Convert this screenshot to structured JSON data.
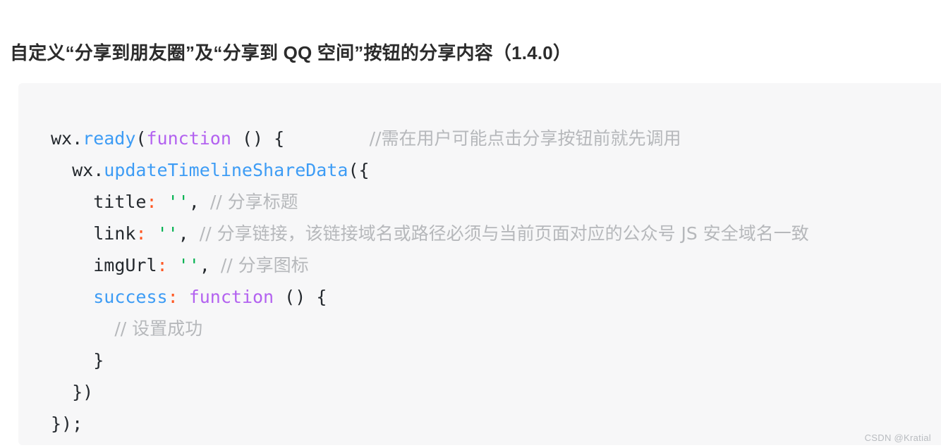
{
  "page": {
    "title": "自定义“分享到朋友圈”及“分享到 QQ 空间”按钮的分享内容（1.4.0）",
    "watermark": "CSDN @Kratial",
    "background_color": "#ffffff"
  },
  "code_block": {
    "background_color": "#f7f7f8",
    "language": "javascript",
    "syntax_colors": {
      "plain": "#24292e",
      "property": "#3d9cf5",
      "keyword": "#b362f0",
      "string": "#00b14f",
      "punctuation": "#ff5722",
      "comment": "#b6b8bb"
    },
    "lines": [
      {
        "indent": "",
        "tokens": [
          {
            "type": "plain",
            "text": "wx."
          },
          {
            "type": "property",
            "text": "ready"
          },
          {
            "type": "plain",
            "text": "("
          },
          {
            "type": "keyword",
            "text": "function"
          },
          {
            "type": "plain",
            "text": " () {"
          },
          {
            "type": "plain",
            "text": "        "
          },
          {
            "type": "comment",
            "text": "//需在用户可能点击分享按钮前就先调用"
          }
        ]
      },
      {
        "indent": "  ",
        "tokens": [
          {
            "type": "plain",
            "text": "wx."
          },
          {
            "type": "property",
            "text": "updateTimelineShareData"
          },
          {
            "type": "plain",
            "text": "({"
          }
        ]
      },
      {
        "indent": "    ",
        "tokens": [
          {
            "type": "plain",
            "text": "title"
          },
          {
            "type": "punctuation",
            "text": ":"
          },
          {
            "type": "plain",
            "text": " "
          },
          {
            "type": "string",
            "text": "''"
          },
          {
            "type": "plain",
            "text": ", "
          },
          {
            "type": "comment",
            "text": "// 分享标题"
          }
        ]
      },
      {
        "indent": "    ",
        "tokens": [
          {
            "type": "plain",
            "text": "link"
          },
          {
            "type": "punctuation",
            "text": ":"
          },
          {
            "type": "plain",
            "text": " "
          },
          {
            "type": "string",
            "text": "''"
          },
          {
            "type": "plain",
            "text": ", "
          },
          {
            "type": "comment",
            "text": "// 分享链接，该链接域名或路径必须与当前页面对应的公众号 JS 安全域名一致"
          }
        ]
      },
      {
        "indent": "    ",
        "tokens": [
          {
            "type": "plain",
            "text": "imgUrl"
          },
          {
            "type": "punctuation",
            "text": ":"
          },
          {
            "type": "plain",
            "text": " "
          },
          {
            "type": "string",
            "text": "''"
          },
          {
            "type": "plain",
            "text": ", "
          },
          {
            "type": "comment",
            "text": "// 分享图标"
          }
        ]
      },
      {
        "indent": "    ",
        "tokens": [
          {
            "type": "property",
            "text": "success"
          },
          {
            "type": "punctuation",
            "text": ":"
          },
          {
            "type": "plain",
            "text": " "
          },
          {
            "type": "keyword",
            "text": "function"
          },
          {
            "type": "plain",
            "text": " () {"
          }
        ]
      },
      {
        "indent": "      ",
        "tokens": [
          {
            "type": "comment",
            "text": "// 设置成功"
          }
        ]
      },
      {
        "indent": "    ",
        "tokens": [
          {
            "type": "plain",
            "text": "}"
          }
        ]
      },
      {
        "indent": "  ",
        "tokens": [
          {
            "type": "plain",
            "text": "})"
          }
        ]
      },
      {
        "indent": "",
        "tokens": [
          {
            "type": "plain",
            "text": "});"
          }
        ]
      }
    ]
  }
}
